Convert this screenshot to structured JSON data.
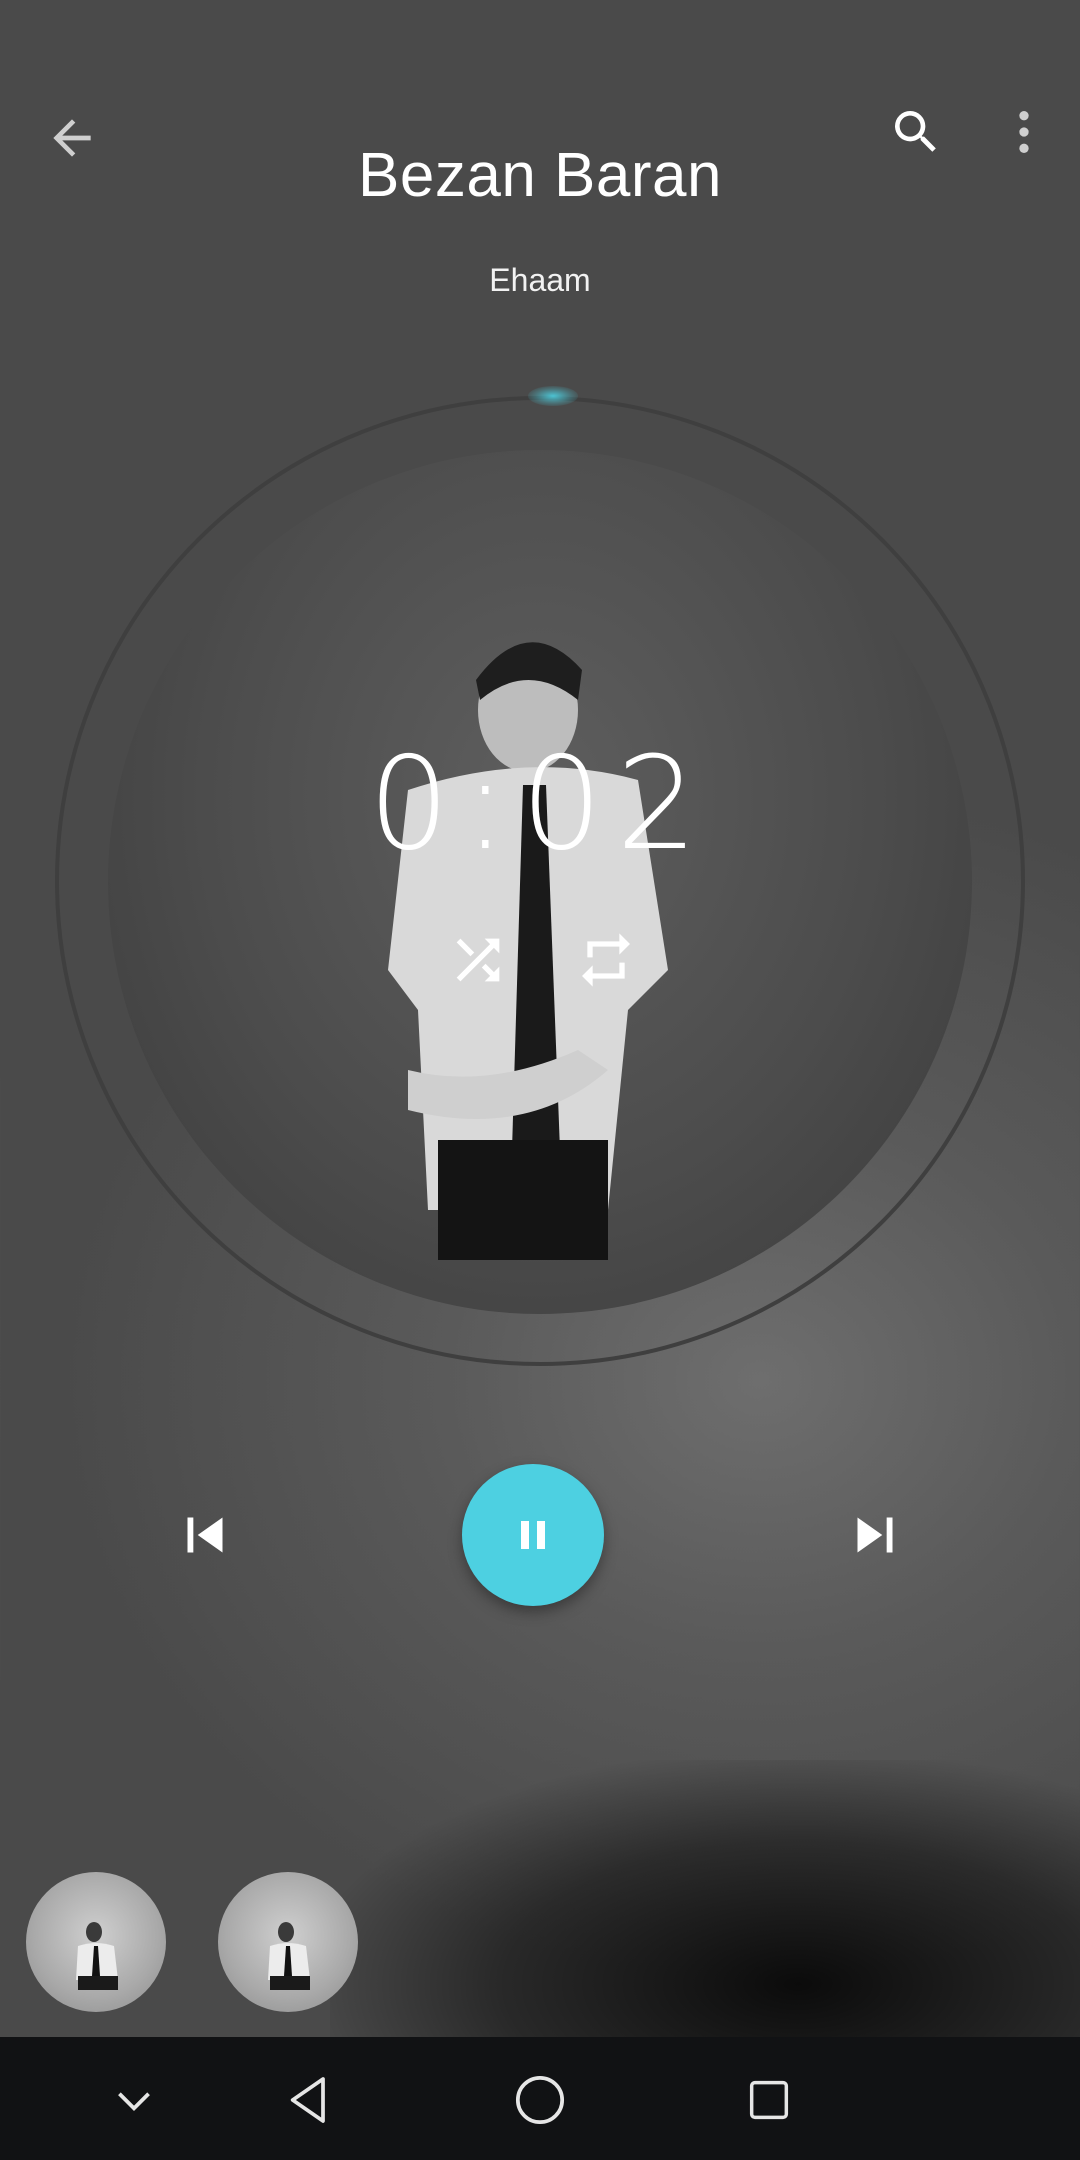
{
  "header": {
    "back_icon": "arrow-left-icon",
    "search_icon": "search-icon",
    "more_icon": "more-vert-icon"
  },
  "track": {
    "title": "Bezan Baran",
    "artist": "Ehaam"
  },
  "player": {
    "elapsed": "0:02",
    "shuffle_icon": "shuffle-icon",
    "repeat_icon": "repeat-icon",
    "prev_icon": "skip-previous-icon",
    "play_icon": "pause-icon",
    "next_icon": "skip-next-icon",
    "accent_color": "#4dd0e1"
  },
  "queue": {
    "thumbnails": [
      "album-art-thumbnail",
      "album-art-thumbnail"
    ]
  },
  "navbar": {
    "items": [
      "chevron-down-icon",
      "back-triangle-icon",
      "home-circle-icon",
      "recents-square-icon"
    ]
  }
}
